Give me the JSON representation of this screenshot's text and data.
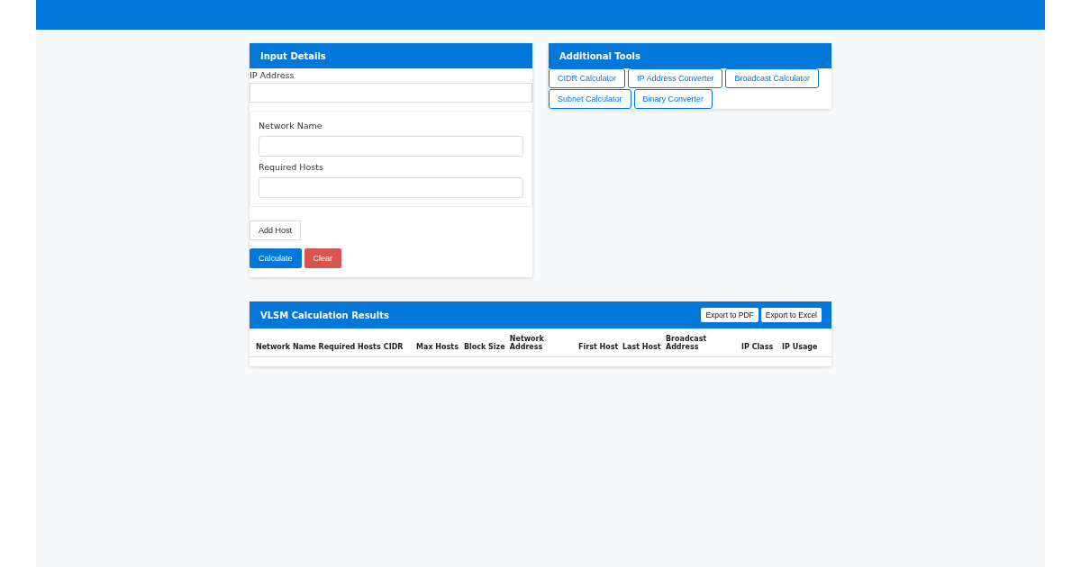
{
  "input_card": {
    "title": "Input Details",
    "ip_label": "IP Address",
    "host_fields": [
      {
        "label": "Network Name"
      },
      {
        "label": "Required Hosts"
      }
    ],
    "add_button": "Add Host",
    "calculate_button": "Calculate",
    "clear_button": "Clear"
  },
  "tools_card": {
    "title": "Additional Tools",
    "buttons": [
      "CIDR Calculator",
      "IP Address Converter",
      "Broadcast Calculator",
      "Subnet Calculator",
      "Binary Converter"
    ]
  },
  "results": {
    "title": "VLSM Calculation Results",
    "export_buttons": [
      "Export to PDF",
      "Export to Excel"
    ],
    "columns": [
      "Network Name",
      "Required Hosts",
      "CIDR",
      "Max Hosts",
      "Block Size",
      "Network Address",
      "First Host",
      "Last Host",
      "Broadcast Address",
      "IP Class",
      "IP Usage"
    ]
  }
}
